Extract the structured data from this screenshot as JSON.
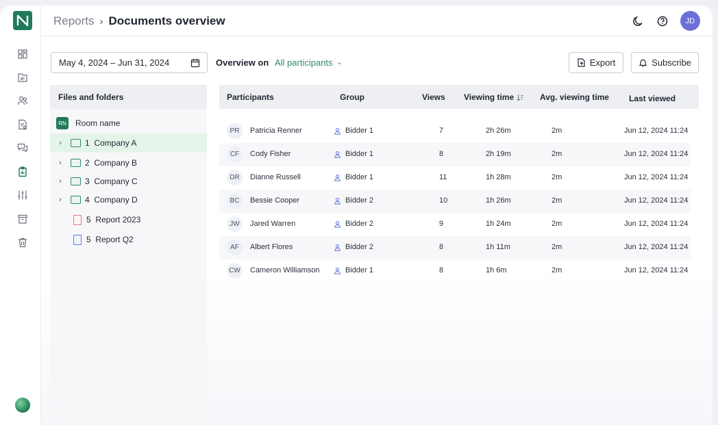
{
  "header": {
    "breadcrumb_parent": "Reports",
    "breadcrumb_current": "Documents overview",
    "user_initials": "JD"
  },
  "filters": {
    "date_range": "May 4, 2024 – Jun 31, 2024",
    "overview_label": "Overview on",
    "overview_value": "All participants",
    "export_label": "Export",
    "subscribe_label": "Subscribe"
  },
  "files": {
    "title": "Files and folders",
    "room_badge": "RN",
    "room_name": "Room name",
    "items": [
      {
        "label": "1  Company A",
        "type": "folder",
        "selected": true
      },
      {
        "label": "2  Company B",
        "type": "folder",
        "selected": false
      },
      {
        "label": "3  Company C",
        "type": "folder",
        "selected": false
      },
      {
        "label": "4  Company D",
        "type": "folder",
        "selected": false
      },
      {
        "label": "5  Report 2023",
        "type": "pdf",
        "selected": false
      },
      {
        "label": "5  Report Q2",
        "type": "doc",
        "selected": false
      }
    ]
  },
  "table": {
    "columns": [
      "Participants",
      "Group",
      "Views",
      "Viewing time",
      "Avg. viewing time",
      "Last viewed"
    ],
    "rows": [
      {
        "initials": "PR",
        "name": "Patricia Renner",
        "group": "Bidder 1",
        "views": "7",
        "time": "2h 26m",
        "avg": "2m",
        "last": "Jun 12, 2024 11:24"
      },
      {
        "initials": "CF",
        "name": "Cody Fisher",
        "group": "Bidder 1",
        "views": "8",
        "time": "2h 19m",
        "avg": "2m",
        "last": "Jun 12, 2024 11:24"
      },
      {
        "initials": "DR",
        "name": "Dianne Russell",
        "group": "Bidder 1",
        "views": "11",
        "time": "1h 28m",
        "avg": "2m",
        "last": "Jun 12, 2024 11:24"
      },
      {
        "initials": "BC",
        "name": "Bessie Cooper",
        "group": "Bidder 2",
        "views": "10",
        "time": "1h 26m",
        "avg": "2m",
        "last": "Jun 12, 2024 11:24"
      },
      {
        "initials": "JW",
        "name": "Jared Warren",
        "group": "Bidder 2",
        "views": "9",
        "time": "1h 24m",
        "avg": "2m",
        "last": "Jun 12, 2024 11:24"
      },
      {
        "initials": "AF",
        "name": "Albert Flores",
        "group": "Bidder 2",
        "views": "8",
        "time": "1h 11m",
        "avg": "2m",
        "last": "Jun 12, 2024 11:24"
      },
      {
        "initials": "CW",
        "name": "Cameron Williamson",
        "group": "Bidder 1",
        "views": "8",
        "time": "1h 6m",
        "avg": "2m",
        "last": "Jun 12, 2024 11:24"
      }
    ]
  },
  "icons": {
    "rail": [
      "dashboard-icon",
      "documents-icon",
      "users-icon",
      "reports-doc-icon",
      "chat-icon",
      "report-clipboard-icon",
      "settings-sliders-icon",
      "archive-icon",
      "trash-icon"
    ]
  }
}
